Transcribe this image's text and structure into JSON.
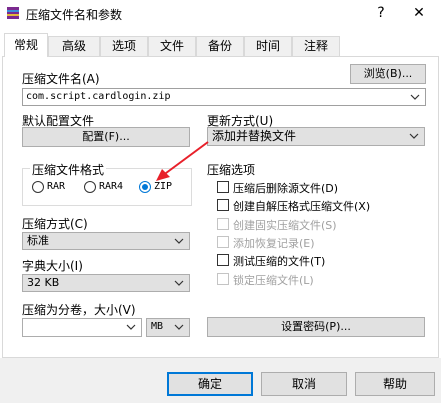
{
  "window": {
    "title": "压缩文件名和参数",
    "help_glyph": "?",
    "close_glyph": "✕"
  },
  "tabs": [
    {
      "label": "常规",
      "active": true
    },
    {
      "label": "高级",
      "active": false
    },
    {
      "label": "选项",
      "active": false
    },
    {
      "label": "文件",
      "active": false
    },
    {
      "label": "备份",
      "active": false
    },
    {
      "label": "时间",
      "active": false
    },
    {
      "label": "注释",
      "active": false
    }
  ],
  "general": {
    "archive_name_label": "压缩文件名(A)",
    "browse_button": "浏览(B)...",
    "archive_name_value": "com.script.cardlogin.zip",
    "default_profile_label": "默认配置文件",
    "profile_button": "配置(F)...",
    "update_mode_label": "更新方式(U)",
    "update_mode_value": "添加并替换文件",
    "format_group_title": "压缩文件格式",
    "formats": [
      {
        "label": "RAR",
        "selected": false
      },
      {
        "label": "RAR4",
        "selected": false
      },
      {
        "label": "ZIP",
        "selected": true
      }
    ],
    "options_group_title": "压缩选项",
    "options": [
      {
        "label": "压缩后删除源文件(D)",
        "enabled": true,
        "checked": false
      },
      {
        "label": "创建自解压格式压缩文件(X)",
        "enabled": true,
        "checked": false
      },
      {
        "label": "创建固实压缩文件(S)",
        "enabled": false,
        "checked": false
      },
      {
        "label": "添加恢复记录(E)",
        "enabled": false,
        "checked": false
      },
      {
        "label": "测试压缩的文件(T)",
        "enabled": true,
        "checked": false
      },
      {
        "label": "锁定压缩文件(L)",
        "enabled": false,
        "checked": false
      }
    ],
    "compression_method_label": "压缩方式(C)",
    "compression_method_value": "标准",
    "dictionary_size_label": "字典大小(I)",
    "dictionary_size_value": "32 KB",
    "split_label": "压缩为分卷，大小(V)",
    "split_value": "",
    "split_unit": "MB",
    "password_button": "设置密码(P)..."
  },
  "footer": {
    "ok_button": "确定",
    "cancel_button": "取消",
    "help_button": "帮助"
  },
  "colors": {
    "accent": "#0078d7",
    "annotation_arrow": "#e8202a",
    "disabled_text": "#a0a0a0"
  }
}
